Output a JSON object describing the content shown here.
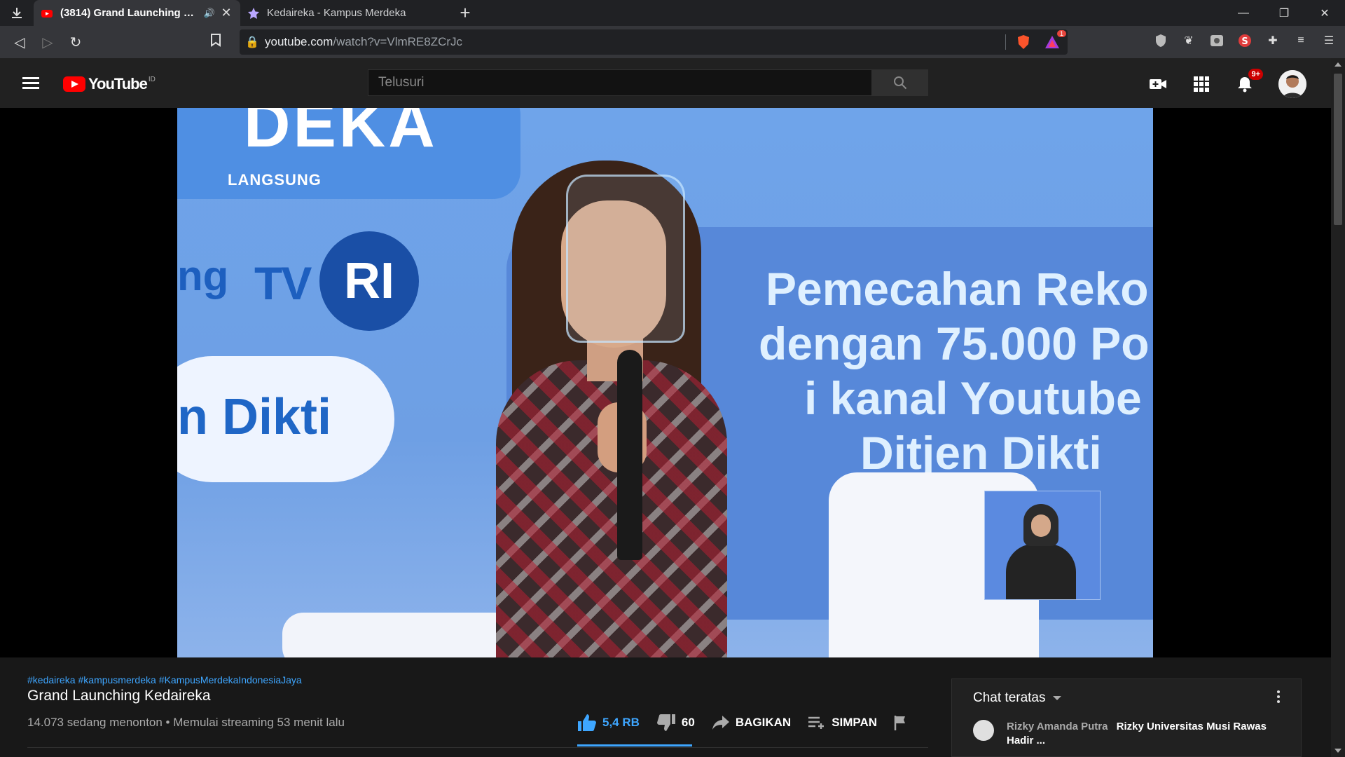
{
  "browser": {
    "tabs": [
      {
        "title": "(3814) Grand Launching Kedaireka",
        "active": true
      },
      {
        "title": "Kedaireka - Kampus Merdeka",
        "active": false
      }
    ],
    "url_host": "youtube.com",
    "url_path": "/watch?v=VlmRE8ZCrJc",
    "rewards_badge": "1"
  },
  "youtube": {
    "logo_text": "YouTube",
    "region": "ID",
    "search_placeholder": "Telusuri",
    "notifications_badge": "9+"
  },
  "video_frame": {
    "top_left_text": "DEKA",
    "langsung": "LANGSUNG",
    "ng_text": "ng",
    "tv_text": "TV",
    "ri_text": "RI",
    "dikti_text": "n Dikti",
    "right_lines": [
      "Pemecahan Reko",
      "dengan 75.000 Po",
      "i kanal Youtube",
      "Ditjen Dikti"
    ]
  },
  "video": {
    "hashtags": [
      "#kedaireka",
      "#kampusmerdeka",
      "#KampusMerdekaIndonesiaJaya"
    ],
    "title": "Grand Launching Kedaireka",
    "meta": "14.073 sedang menonton • Memulai streaming 53 menit lalu",
    "likes": "5,4 RB",
    "dislikes": "60",
    "share_label": "BAGIKAN",
    "save_label": "SIMPAN"
  },
  "chat": {
    "header": "Chat teratas",
    "messages": [
      {
        "author": "Rizky Amanda Putra",
        "text": "Rizky Universitas Musi Rawas Hadir ..."
      }
    ]
  },
  "colors": {
    "accent_blue": "#3ea6ff",
    "youtube_red": "#ff0000",
    "background": "#181818"
  }
}
